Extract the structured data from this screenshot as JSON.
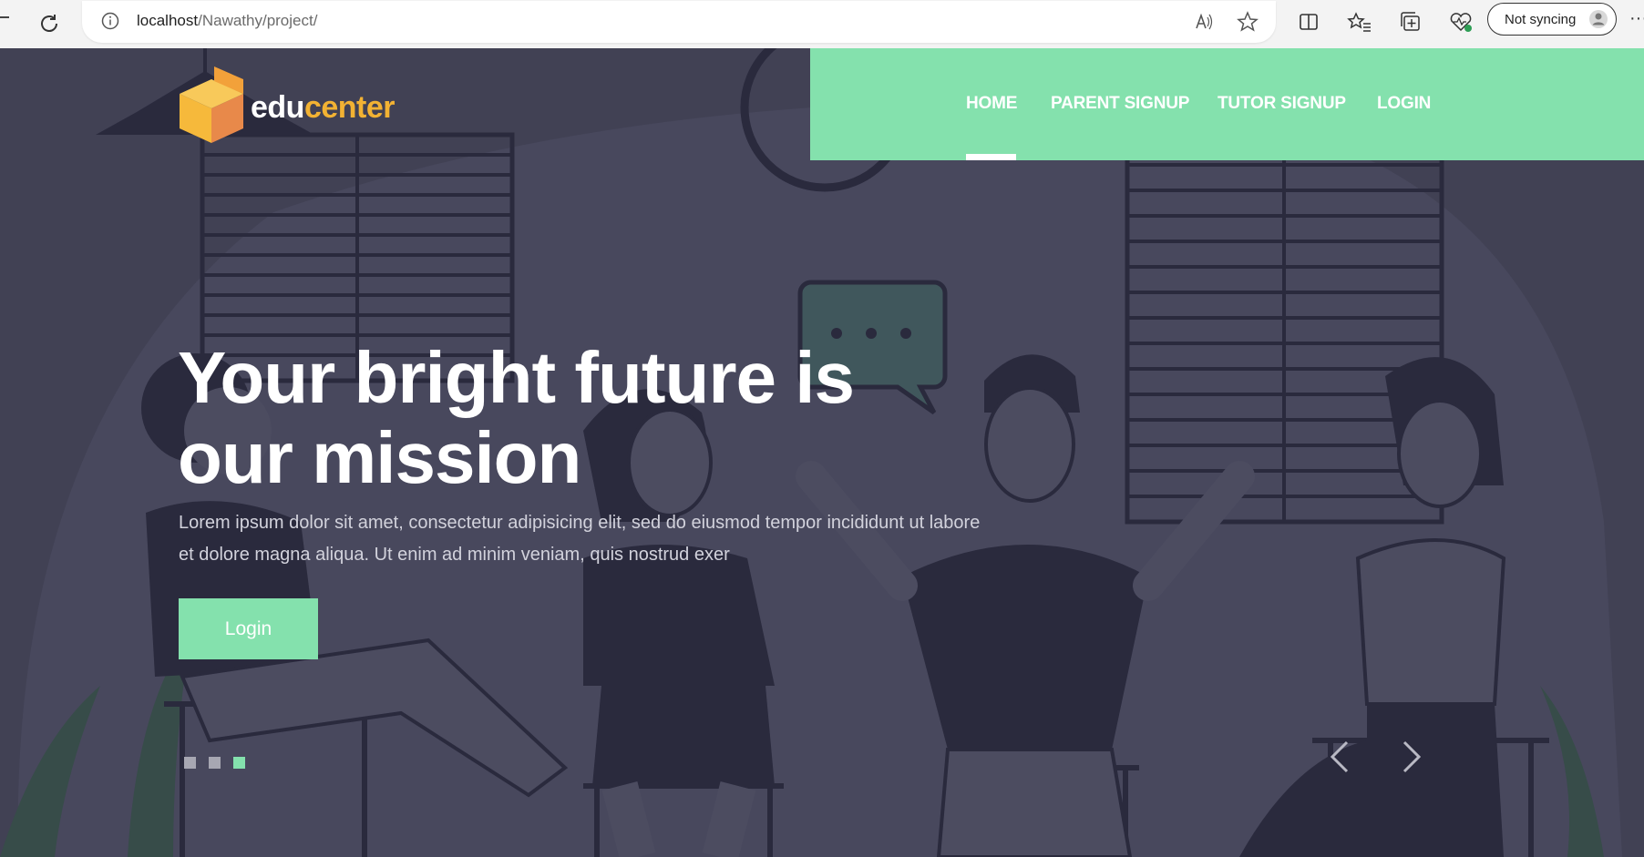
{
  "browser": {
    "url_host": "localhost",
    "url_path": "/Nawathy/project/",
    "sync_label": "Not syncing"
  },
  "site": {
    "logo": {
      "part1": "edu",
      "part2": "center"
    },
    "nav": [
      {
        "label": "Home",
        "active": true
      },
      {
        "label": "Parent Signup",
        "active": false
      },
      {
        "label": "Tutor Signup",
        "active": false
      },
      {
        "label": "Login",
        "active": false
      }
    ],
    "hero": {
      "headline_line1": "Your bright future is",
      "headline_line2": "our mission",
      "subtext": "Lorem ipsum dolor sit amet, consectetur adipisicing elit, sed do eiusmod tempor incididunt ut labore et dolore magna aliqua. Ut enim ad minim veniam, quis nostrud exer",
      "cta_label": "Login"
    },
    "slider": {
      "total": 3,
      "active_index": 2
    }
  },
  "colors": {
    "accent": "#84e1ad",
    "logo_orange": "#f2b233",
    "hero_bg": "#4b4b5f"
  }
}
